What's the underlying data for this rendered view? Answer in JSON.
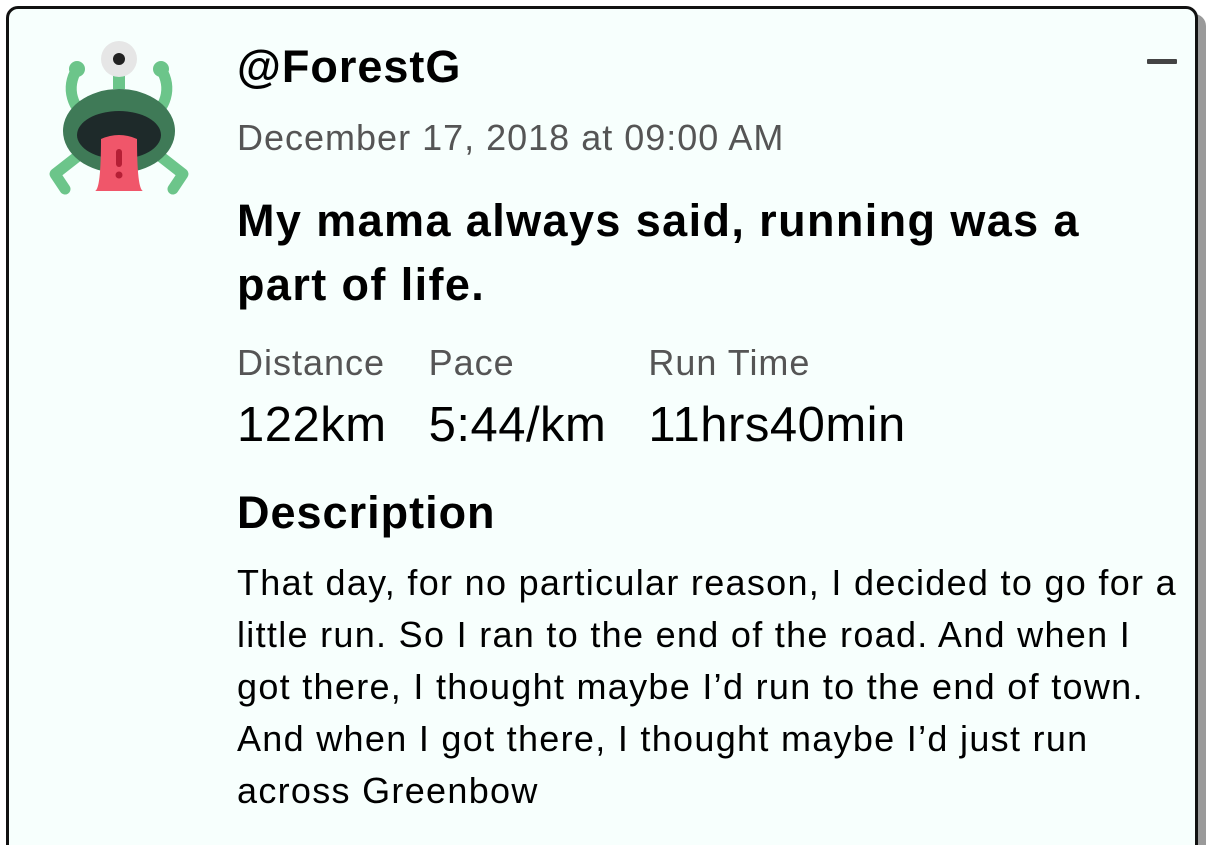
{
  "post": {
    "username": "@ForestG",
    "timestamp": "December 17, 2018 at 09:00 AM",
    "title": "My mama always said, running was a part of life.",
    "avatar_icon": "alien-monster-icon",
    "collapse_icon": "minus-icon",
    "stats": [
      {
        "label": "Distance",
        "value": "122km"
      },
      {
        "label": "Pace",
        "value": "5:44/km"
      },
      {
        "label": "Run Time",
        "value": "11hrs40min"
      }
    ],
    "description_heading": "Description",
    "description": "That day, for no particular reason, I decided to go for a little run. So I ran to the end of the road. And when I got there, I thought maybe I’d run to the end of town. And when I got there, I thought maybe I’d just run across Greenbow"
  },
  "colors": {
    "card_background": "#f7fffd",
    "card_border": "#111111",
    "muted_text": "#555555",
    "avatar_green": "#6cc58a",
    "avatar_dark_green": "#3f7a57",
    "avatar_tongue": "#f0566a"
  }
}
